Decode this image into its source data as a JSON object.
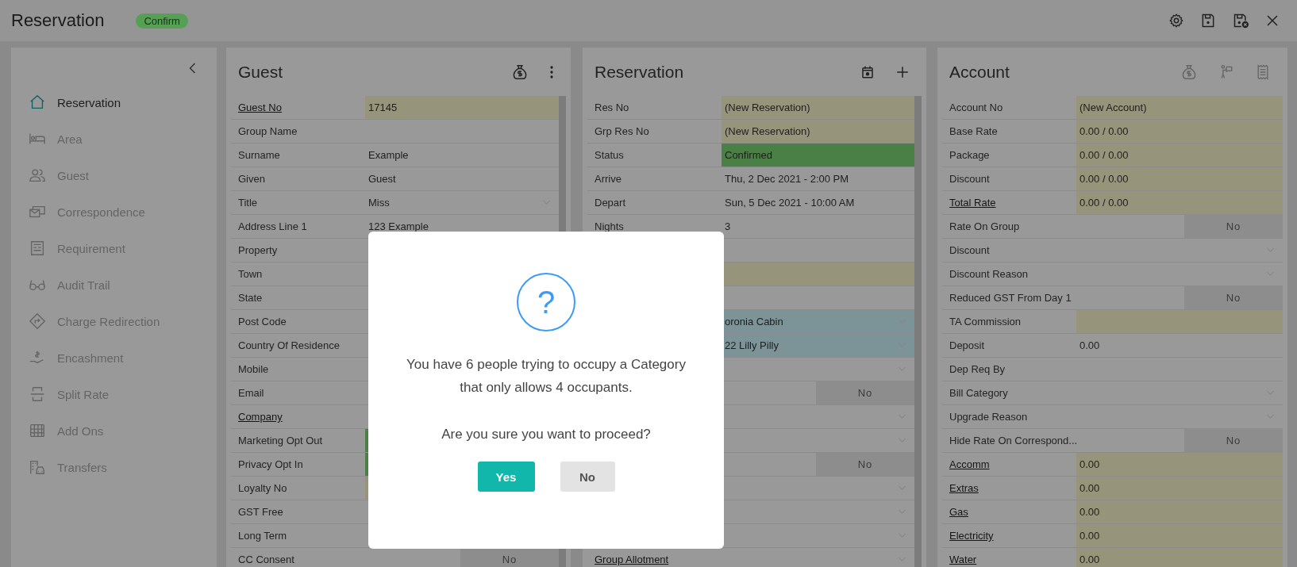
{
  "header": {
    "title": "Reservation",
    "badge": "Confirm"
  },
  "sidebar": {
    "items": [
      {
        "label": "Reservation",
        "selected": true
      },
      {
        "label": "Area",
        "selected": false
      },
      {
        "label": "Guest",
        "selected": false
      },
      {
        "label": "Correspondence",
        "selected": false
      },
      {
        "label": "Requirement",
        "selected": false
      },
      {
        "label": "Audit Trail",
        "selected": false
      },
      {
        "label": "Charge Redirection",
        "selected": false
      },
      {
        "label": "Encashment",
        "selected": false
      },
      {
        "label": "Split Rate",
        "selected": false
      },
      {
        "label": "Add Ons",
        "selected": false
      },
      {
        "label": "Transfers",
        "selected": false
      }
    ]
  },
  "panels": [
    {
      "title": "Guest",
      "actions_disabled": false,
      "scrollable": true,
      "rows": [
        {
          "label": "Guest No",
          "link": true,
          "kind": "text",
          "value": "17145",
          "color": "#96947a"
        },
        {
          "label": "Group Name",
          "link": false,
          "kind": "text"
        },
        {
          "label": "Surname",
          "link": false,
          "kind": "text",
          "value": "Example"
        },
        {
          "label": "Given",
          "link": false,
          "kind": "text",
          "value": "Guest"
        },
        {
          "label": "Title",
          "link": false,
          "kind": "select",
          "value": "Miss"
        },
        {
          "label": "Address Line 1",
          "link": false,
          "kind": "text",
          "value": "123 Example"
        },
        {
          "label": "Property",
          "link": false,
          "kind": "text"
        },
        {
          "label": "Town",
          "link": false,
          "kind": "text"
        },
        {
          "label": "State",
          "link": false,
          "kind": "text"
        },
        {
          "label": "Post Code",
          "link": false,
          "kind": "text"
        },
        {
          "label": "Country Of Residence",
          "link": false,
          "kind": "text"
        },
        {
          "label": "Mobile",
          "link": false,
          "kind": "text"
        },
        {
          "label": "Email",
          "link": false,
          "kind": "text"
        },
        {
          "label": "Company",
          "link": true,
          "kind": "text"
        },
        {
          "label": "Marketing Opt Out",
          "link": false,
          "kind": "text",
          "color": "#4a7f45"
        },
        {
          "label": "Privacy Opt In",
          "link": false,
          "kind": "text",
          "color": "#4a7f45"
        },
        {
          "label": "Loyalty No",
          "link": false,
          "kind": "text",
          "color": "#96947a"
        },
        {
          "label": "GST Free",
          "link": false,
          "kind": "text"
        },
        {
          "label": "Long Term",
          "link": false,
          "kind": "text"
        },
        {
          "label": "CC Consent",
          "link": false,
          "kind": "toggle",
          "value": "No",
          "on": false
        }
      ]
    },
    {
      "title": "Reservation",
      "actions_disabled": false,
      "scrollable": true,
      "rows": [
        {
          "label": "Res No",
          "link": false,
          "kind": "text",
          "value": "(New Reservation)",
          "color": "#96947a"
        },
        {
          "label": "Grp Res No",
          "link": false,
          "kind": "text",
          "value": "(New Reservation)",
          "color": "#96947a"
        },
        {
          "label": "Status",
          "link": false,
          "kind": "text",
          "value": "Confirmed",
          "color": "#4a7f45"
        },
        {
          "label": "Arrive",
          "link": false,
          "kind": "text",
          "value": "Thu, 2 Dec 2021 - 2:00 PM"
        },
        {
          "label": "Depart",
          "link": false,
          "kind": "text",
          "value": "Sun, 5 Dec 2021 - 10:00 AM"
        },
        {
          "label": "Nights",
          "link": false,
          "kind": "text",
          "value": "3"
        },
        {
          "kind": "text"
        },
        {
          "kind": "text",
          "color": "#96947a"
        },
        {
          "kind": "text"
        },
        {
          "kind": "select",
          "value": "oronia Cabin",
          "color": "#7c9497"
        },
        {
          "kind": "select",
          "value": "22 Lilly Pilly",
          "color": "#7c9497"
        },
        {
          "kind": "select"
        },
        {
          "kind": "toggle",
          "value": "No",
          "on": false
        },
        {
          "kind": "select"
        },
        {
          "kind": "select"
        },
        {
          "kind": "toggle",
          "value": "No",
          "on": false
        },
        {
          "kind": "select"
        },
        {
          "kind": "select"
        },
        {
          "kind": "select"
        },
        {
          "label": "Group Allotment",
          "link": true,
          "kind": "select"
        }
      ]
    },
    {
      "title": "Account",
      "actions_disabled": true,
      "scrollable": false,
      "rows": [
        {
          "label": "Account No",
          "link": false,
          "kind": "text",
          "value": "(New Account)",
          "color": "#96947a"
        },
        {
          "label": "Base Rate",
          "link": false,
          "kind": "text",
          "value": "0.00 / 0.00",
          "color": "#96947a"
        },
        {
          "label": "Package",
          "link": false,
          "kind": "text",
          "value": "0.00 / 0.00",
          "color": "#96947a"
        },
        {
          "label": "Discount",
          "link": false,
          "kind": "text",
          "value": "0.00 / 0.00",
          "color": "#96947a"
        },
        {
          "label": "Total Rate",
          "link": true,
          "kind": "text",
          "value": "0.00 / 0.00",
          "color": "#96947a"
        },
        {
          "label": "Rate On Group",
          "link": false,
          "kind": "toggle",
          "value": "No",
          "on": false
        },
        {
          "label": "Discount",
          "link": false,
          "kind": "select"
        },
        {
          "label": "Discount Reason",
          "link": false,
          "kind": "select"
        },
        {
          "label": "Reduced GST From Day 1",
          "link": false,
          "kind": "toggle",
          "value": "No",
          "on": false
        },
        {
          "label": "TA Commission",
          "link": false,
          "kind": "text",
          "color": "#96947a"
        },
        {
          "label": "Deposit",
          "link": false,
          "kind": "text",
          "value": "0.00"
        },
        {
          "label": "Dep Req By",
          "link": false,
          "kind": "text"
        },
        {
          "label": "Bill Category",
          "link": false,
          "kind": "select"
        },
        {
          "label": "Upgrade Reason",
          "link": false,
          "kind": "select"
        },
        {
          "label": "Hide Rate On Correspond...",
          "link": false,
          "kind": "toggle",
          "value": "No",
          "on": false
        },
        {
          "label": "Accomm",
          "link": true,
          "kind": "text",
          "value": "0.00",
          "color": "#96947a"
        },
        {
          "label": "Extras",
          "link": true,
          "kind": "text",
          "value": "0.00",
          "color": "#96947a"
        },
        {
          "label": "Gas",
          "link": true,
          "kind": "text",
          "value": "0.00",
          "color": "#96947a"
        },
        {
          "label": "Electricity",
          "link": true,
          "kind": "text",
          "value": "0.00",
          "color": "#96947a"
        },
        {
          "label": "Water",
          "link": true,
          "kind": "text",
          "value": "0.00",
          "color": "#96947a"
        }
      ]
    }
  ],
  "dialog": {
    "icon": "?",
    "message": "You have 6 people trying to occupy a Category that only allows 4 occupants.",
    "question": "Are you sure you want to proceed?",
    "buttons": [
      {
        "label": "Yes",
        "kind": "primary"
      },
      {
        "label": "No",
        "kind": "secondary"
      }
    ]
  }
}
